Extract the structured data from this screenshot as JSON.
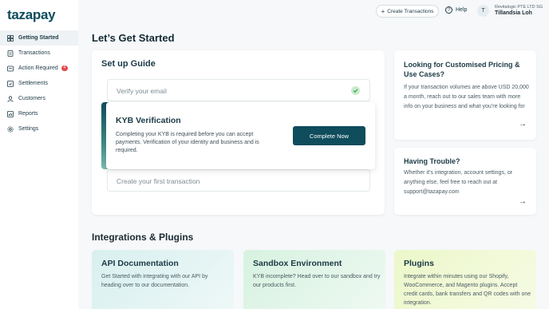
{
  "brand": {
    "logo_text": "tazapay"
  },
  "sidebar": {
    "items": [
      {
        "label": "Getting Started",
        "icon": "grid-icon"
      },
      {
        "label": "Transactions",
        "icon": "document-icon"
      },
      {
        "label": "Action Required",
        "icon": "bell-icon",
        "badge": "4"
      },
      {
        "label": "Settlements",
        "icon": "receipt-icon"
      },
      {
        "label": "Customers",
        "icon": "user-icon"
      },
      {
        "label": "Reports",
        "icon": "chart-icon"
      },
      {
        "label": "Settings",
        "icon": "gear-icon"
      }
    ]
  },
  "header": {
    "create_transactions": "Create Transactions",
    "help": "Help",
    "avatar_initial": "T",
    "org_name": "Revitalogic PTE LTD SG",
    "user_name": "Tillandsia Loh"
  },
  "main": {
    "title": "Let’s Get Started",
    "setup_guide": {
      "title": "Set up Guide",
      "steps": [
        {
          "label": "Verify your email",
          "status": "done"
        },
        {
          "label": "KYB Verification",
          "description": "Completing your KYB is required before you can accept payments. Verification of your identity and business and is required.",
          "cta": "Complete Now"
        },
        {
          "label": "Create your first transaction"
        }
      ]
    },
    "cards": [
      {
        "title": "Looking for Customised Pricing & Use Cases?",
        "body": "If your transaction volumes are above USD 20,000 a month, reach out to our sales team with more info on your business and what you’re looking for",
        "arrow": "→"
      },
      {
        "title": "Having Trouble?",
        "body": "Whether it’s integration, account settings, or anything else, feel free to reach out at support@tazapay.com",
        "arrow": "→"
      }
    ],
    "integrations": {
      "title": "Integrations & Plugins",
      "items": [
        {
          "title": "API Documentation",
          "body": "Get Started with integrating with our API by heading over to our documentation."
        },
        {
          "title": "Sandbox Environment",
          "body": "KYB incomplete? Head over to our sandbox and try our products first."
        },
        {
          "title": "Plugins",
          "body": "Integrate within minutes using our Shopify, WooCommerce, and Magento plugins. Accept credit cards, bank transfers and QR codes with one integration."
        }
      ]
    }
  },
  "colors": {
    "brand": "#0f4c5c",
    "badge": "#e5484d",
    "success": "#2e9e4f"
  }
}
